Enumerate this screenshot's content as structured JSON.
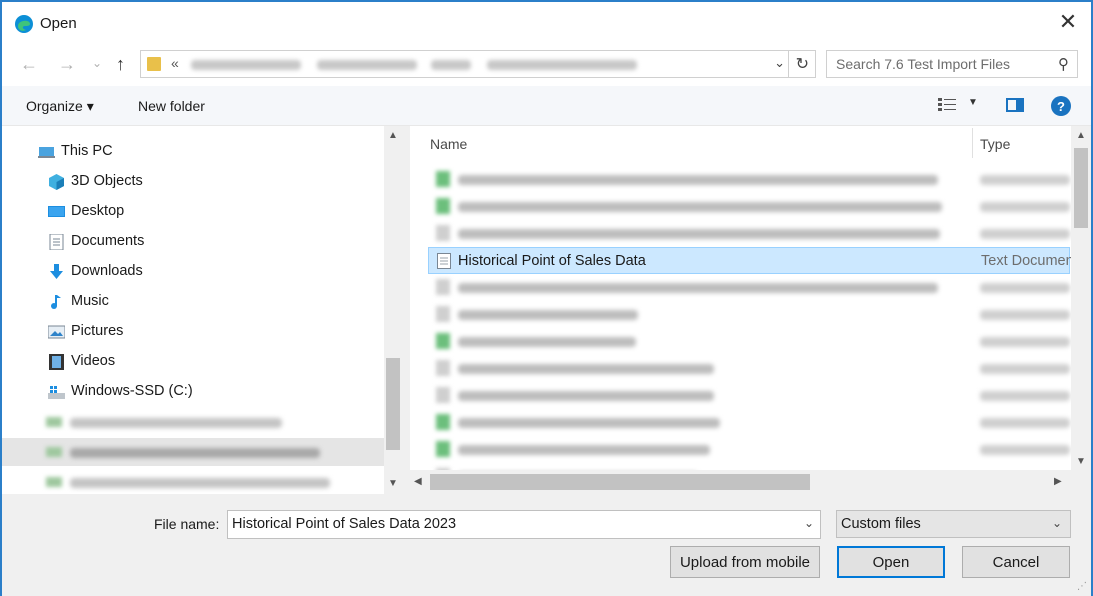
{
  "window": {
    "title": "Open"
  },
  "nav": {
    "address_prefix": "«",
    "search_placeholder": "Search 7.6 Test Import Files"
  },
  "toolbar": {
    "organize_label": "Organize ▾",
    "new_folder_label": "New folder"
  },
  "sidebar": {
    "items": [
      {
        "label": "This PC",
        "icon": "computer-icon"
      },
      {
        "label": "3D Objects",
        "icon": "cube-icon"
      },
      {
        "label": "Desktop",
        "icon": "desktop-icon"
      },
      {
        "label": "Documents",
        "icon": "document-icon"
      },
      {
        "label": "Downloads",
        "icon": "download-icon"
      },
      {
        "label": "Music",
        "icon": "music-icon"
      },
      {
        "label": "Pictures",
        "icon": "picture-icon"
      },
      {
        "label": "Videos",
        "icon": "video-icon"
      },
      {
        "label": "Windows-SSD (C:)",
        "icon": "drive-icon"
      }
    ]
  },
  "list": {
    "columns": [
      "Name",
      "Type"
    ],
    "selected_row": {
      "name": "Historical Point of Sales Data",
      "type": "Text Documen"
    }
  },
  "footer": {
    "file_name_label": "File name:",
    "file_name_value": "Historical Point of Sales Data 2023",
    "file_type_value": "Custom files",
    "upload_label": "Upload from mobile",
    "open_label": "Open",
    "cancel_label": "Cancel"
  },
  "colors": {
    "accent": "#0078d7",
    "selection": "#cce8ff",
    "border": "#2b7fc9"
  }
}
